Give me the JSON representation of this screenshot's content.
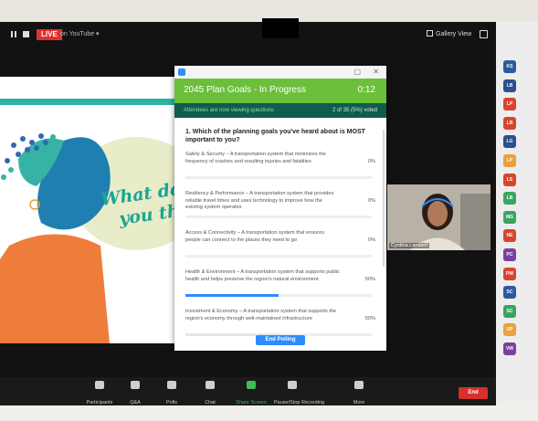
{
  "topbar": {
    "live_label": "LIVE",
    "stream_label": "on YouTube ▾",
    "gallery_label": "Gallery View"
  },
  "slide": {
    "text_line1": "What do",
    "text_line2": "you thi"
  },
  "poll": {
    "title": "2045 Plan Goals - In Progress",
    "timer": "0:12",
    "subtitle": "Attendees are now viewing questions",
    "votes": "2 of 35 (5%) voted",
    "question": "1. Which of the planning goals you've heard about is MOST important to you?",
    "options": [
      {
        "text": "Safety & Security – A transportation system that minimizes the frequency of crashes and resulting injuries and fatalities",
        "pct": "0%",
        "fill": 0.0
      },
      {
        "text": "Resiliency & Performance – A transportation system that provides reliable travel times and uses technology to improve how the existing system operates",
        "pct": "0%",
        "fill": 0.0
      },
      {
        "text": "Access & Connectivity – A transportation system that ensures people can connect to the places they need to go",
        "pct": "0%",
        "fill": 0.0
      },
      {
        "text": "Health & Environment – A transportation system that supports public health and helps preserve the region's natural environment",
        "pct": "50%",
        "fill": 0.5
      },
      {
        "text": "Investment & Economy – A transportation system that supports the region's economy through well-maintained infrastructure",
        "pct": "50%",
        "fill": 0.5
      }
    ],
    "end_label": "End Polling"
  },
  "video": {
    "name": "Cynthia Lambert"
  },
  "toolbar": {
    "items": [
      {
        "label": "Participants",
        "icon": "participants-icon"
      },
      {
        "label": "Q&A",
        "icon": "qa-icon"
      },
      {
        "label": "Polls",
        "icon": "polls-icon"
      },
      {
        "label": "Chat",
        "icon": "chat-icon"
      },
      {
        "label": "Share Screen",
        "icon": "share-screen-icon"
      },
      {
        "label": "Pause/Stop Recording",
        "icon": "recording-icon"
      },
      {
        "label": "More",
        "icon": "more-icon"
      }
    ],
    "end_label": "End"
  },
  "participants": [
    {
      "initials": "KS",
      "color": "#2b5aa3"
    },
    {
      "initials": "LB",
      "color": "#2c4f8e"
    },
    {
      "initials": "LP",
      "color": "#d9442e"
    },
    {
      "initials": "LB",
      "color": "#d9442e"
    },
    {
      "initials": "LG",
      "color": "#2c4f8e"
    },
    {
      "initials": "LP",
      "color": "#e8a23a"
    },
    {
      "initials": "LS",
      "color": "#d9442e"
    },
    {
      "initials": "LB",
      "color": "#3aa562"
    },
    {
      "initials": "MG",
      "color": "#3aa562"
    },
    {
      "initials": "NE",
      "color": "#d9442e"
    },
    {
      "initials": "PC",
      "color": "#7b3fa0"
    },
    {
      "initials": "PW",
      "color": "#d9442e"
    },
    {
      "initials": "SC",
      "color": "#2b5aa3"
    },
    {
      "initials": "SC",
      "color": "#3aa562"
    },
    {
      "initials": "UP",
      "color": "#e8a23a"
    },
    {
      "initials": "VW",
      "color": "#7b3fa0"
    }
  ]
}
